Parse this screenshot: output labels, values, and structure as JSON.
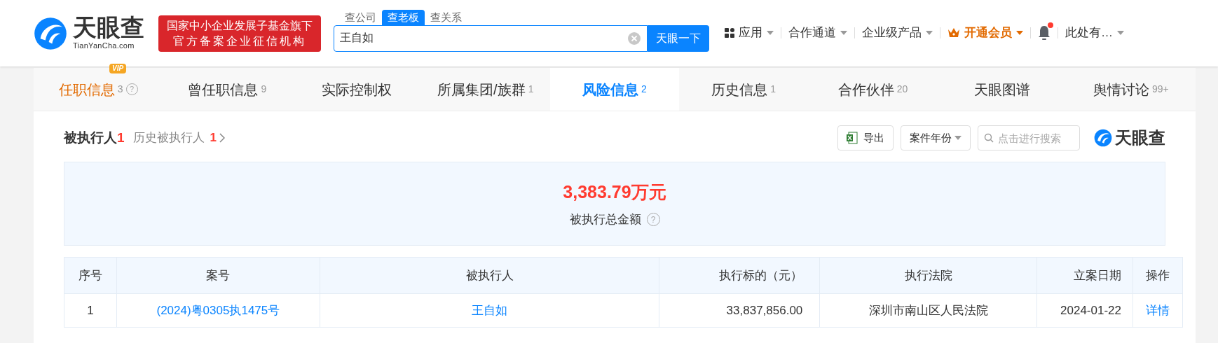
{
  "header": {
    "logo": {
      "name": "天眼查",
      "domain": "TianYanCha.com"
    },
    "badge": [
      "国家中小企业发展子基金旗下",
      "官方备案企业征信机构"
    ],
    "search_tabs": [
      {
        "label": "查公司",
        "selected": false
      },
      {
        "label": "查老板",
        "selected": true
      },
      {
        "label": "查关系",
        "selected": false
      }
    ],
    "search": {
      "value": "王自如",
      "button": "天眼一下"
    },
    "nav": [
      {
        "kind": "apps",
        "label": "应用"
      },
      {
        "kind": "menu",
        "label": "合作通道"
      },
      {
        "kind": "menu",
        "label": "企业级产品"
      },
      {
        "kind": "vip",
        "label": "开通会员"
      },
      {
        "kind": "bell",
        "unread": true
      },
      {
        "kind": "menu",
        "label": "此处有…"
      }
    ]
  },
  "tabs": [
    {
      "label": "任职信息",
      "count": "3",
      "selected": false,
      "badge": "VIP",
      "help": "?"
    },
    {
      "label": "曾任职信息",
      "count": "9",
      "selected": false
    },
    {
      "label": "实际控制权",
      "selected": false
    },
    {
      "label": "所属集团/族群",
      "count": "1",
      "selected": false
    },
    {
      "label": "风险信息",
      "count": "2",
      "selected": true
    },
    {
      "label": "历史信息",
      "count": "1",
      "selected": false
    },
    {
      "label": "合作伙伴",
      "count": "20",
      "selected": false
    },
    {
      "label": "天眼图谱",
      "selected": false
    },
    {
      "label": "舆情讨论",
      "count": "99+",
      "selected": false
    }
  ],
  "section": {
    "title": "被执行人",
    "count": "1",
    "history_label": "历史被执行人",
    "history_count": "1",
    "export_button": "导出",
    "year_filter": "案件年份",
    "search_placeholder": "点击进行搜索",
    "watermark_logo": "天眼查"
  },
  "summary": {
    "amount": "3,383.79万元",
    "label": "被执行总金额",
    "help": "?"
  },
  "table": {
    "columns": [
      "序号",
      "案号",
      "被执行人",
      "执行标的（元）",
      "执行法院",
      "立案日期",
      "操作"
    ],
    "rows": [
      [
        "1",
        "(2024)粤0305执1475号",
        "王自如",
        "33,837,856.00",
        "深圳市南山区人民法院",
        "2024-01-22",
        "详情"
      ]
    ]
  }
}
